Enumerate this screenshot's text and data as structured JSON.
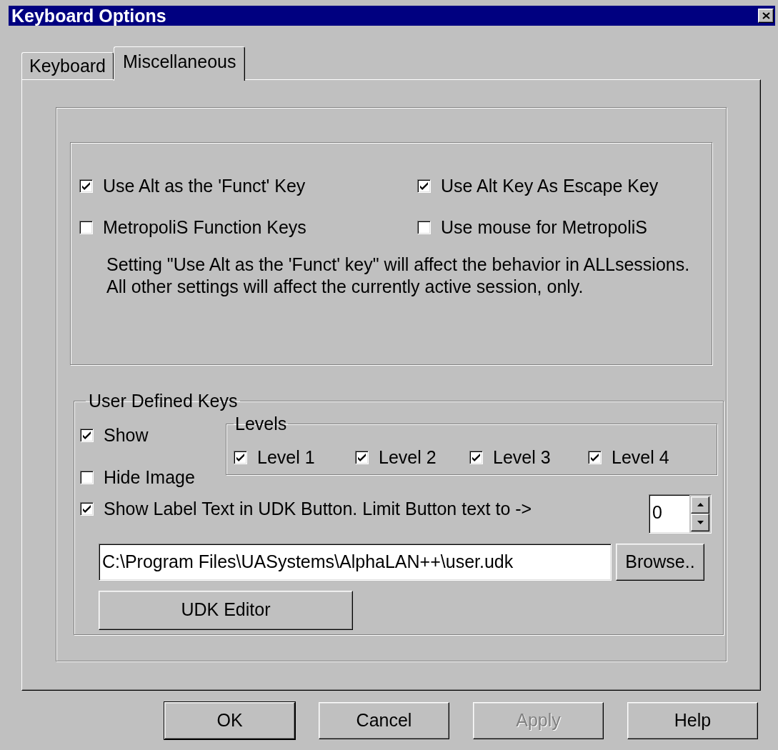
{
  "window": {
    "title": "Keyboard Options"
  },
  "tabs": [
    {
      "label": "Keyboard",
      "selected": false
    },
    {
      "label": "Miscellaneous",
      "selected": true
    }
  ],
  "options": [
    {
      "label": "Use Alt as the 'Funct' Key",
      "checked": true
    },
    {
      "label": "Use Alt Key As Escape Key",
      "checked": true
    },
    {
      "label": "MetropoliS Function Keys",
      "checked": false
    },
    {
      "label": "Use mouse for MetropoliS",
      "checked": false
    }
  ],
  "note": "Setting \"Use Alt as the 'Funct' key\" will affect the behavior in ALLsessions. All other settings will affect the currently active session, only.",
  "user_defined_keys": {
    "title": "User Defined Keys",
    "toggles": [
      {
        "label": "Show",
        "checked": true
      },
      {
        "label": "Hide Image",
        "checked": false
      }
    ],
    "levels": {
      "title": "Levels",
      "items": [
        {
          "label": "Level 1",
          "checked": true
        },
        {
          "label": "Level 2",
          "checked": true
        },
        {
          "label": "Level 3",
          "checked": true
        },
        {
          "label": "Level 4",
          "checked": true
        }
      ]
    },
    "show_label_text": {
      "label": "Show Label Text in UDK Button. Limit Button text to ->",
      "checked": true
    },
    "limit_spinner": {
      "value": "0"
    },
    "path_field": {
      "value": "C:\\Program Files\\UASystems\\AlphaLAN++\\user.udk"
    },
    "browse_button": "Browse..",
    "udk_editor_button": "UDK Editor"
  },
  "buttons": [
    {
      "label": "OK",
      "default": true,
      "disabled": false
    },
    {
      "label": "Cancel",
      "default": false,
      "disabled": false
    },
    {
      "label": "Apply",
      "default": false,
      "disabled": true
    },
    {
      "label": "Help",
      "default": false,
      "disabled": false
    }
  ]
}
